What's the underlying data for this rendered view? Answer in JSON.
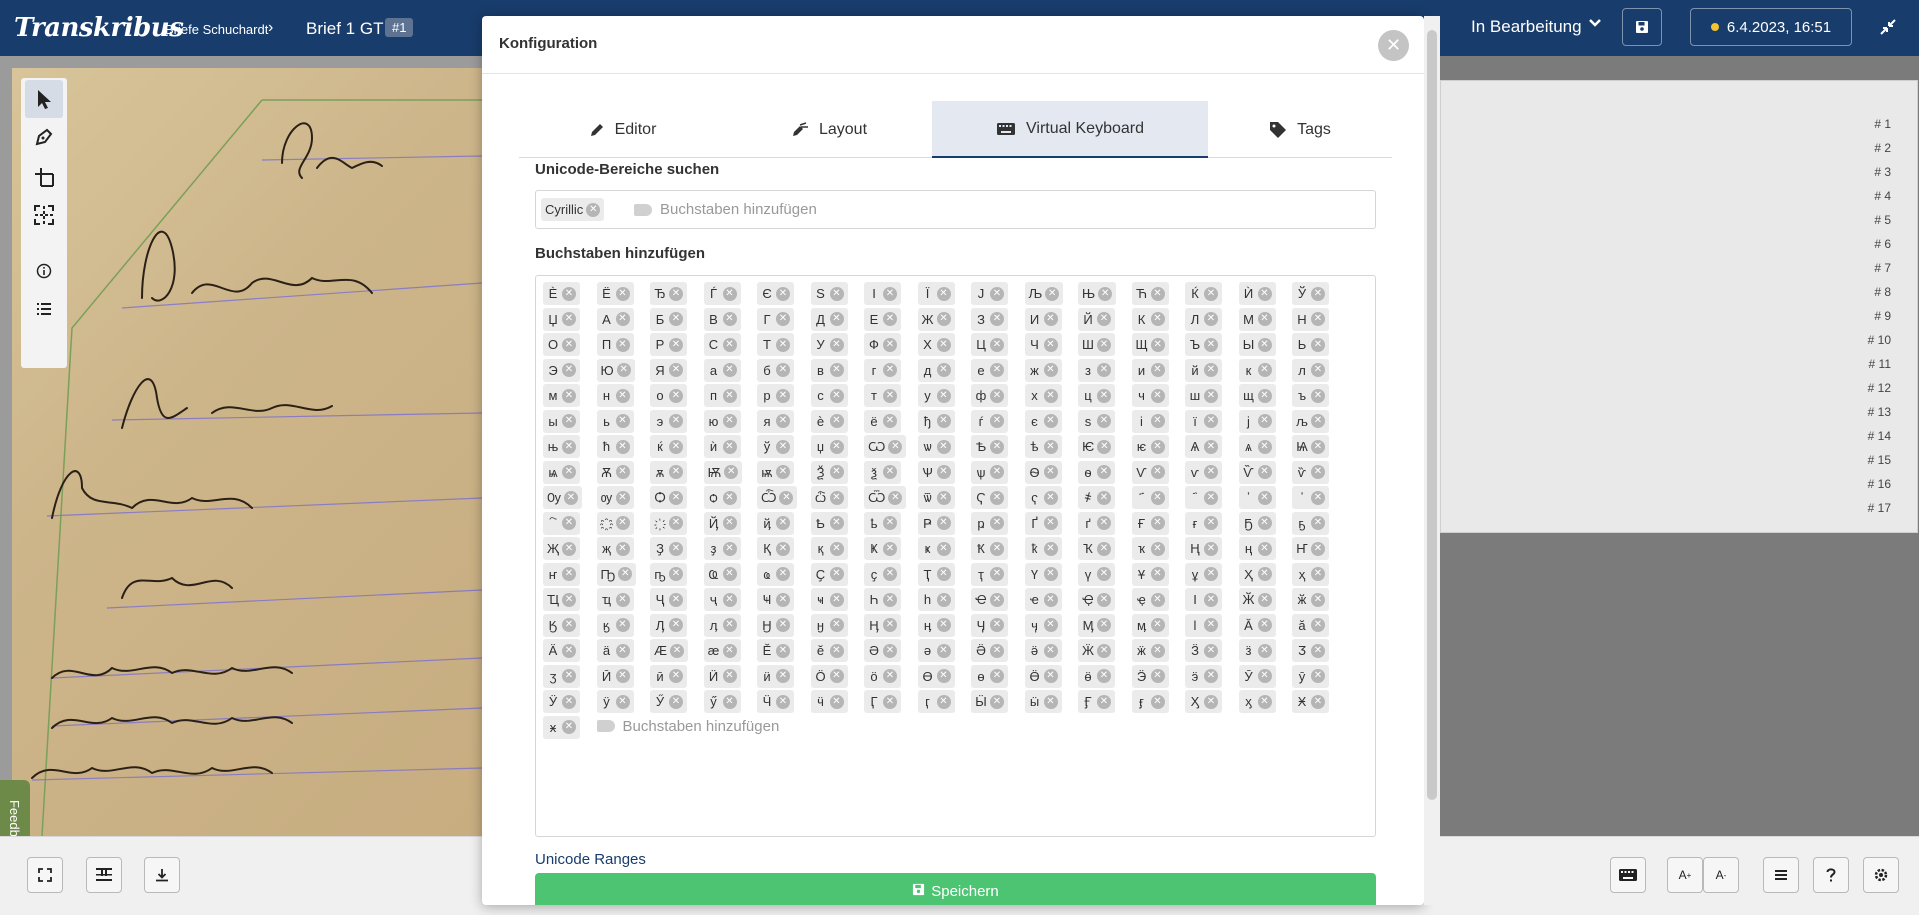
{
  "topbar": {
    "logo": "Transkribus",
    "breadcrumb_collection": "Briefe Schuchardt",
    "breadcrumb_sep": "›",
    "breadcrumb_document": "Brief 1 GT",
    "document_badge": "#1",
    "status": "In Bearbeitung",
    "date": "6.4.2023, 16:51"
  },
  "feedback_label": "Feedback",
  "line_numbers": [
    "# 1",
    "# 2",
    "# 3",
    "# 4",
    "# 5",
    "# 6",
    "# 7",
    "# 8",
    "# 9",
    "# 10",
    "# 11",
    "# 12",
    "# 13",
    "# 14",
    "# 15",
    "# 16",
    "# 17"
  ],
  "modal": {
    "title": "Konfiguration",
    "tabs": [
      {
        "label": "Editor",
        "icon": "pencil-icon"
      },
      {
        "label": "Layout",
        "icon": "layout-icon"
      },
      {
        "label": "Virtual Keyboard",
        "icon": "keyboard-icon"
      },
      {
        "label": "Tags",
        "icon": "tag-icon"
      }
    ],
    "active_tab": "Virtual Keyboard",
    "unicode_search_label": "Unicode-Bereiche suchen",
    "selected_range": "Cyrillic",
    "search_placeholder": "Buchstaben hinzufügen",
    "letters_label": "Buchstaben hinzufügen",
    "letters_placeholder": "Buchstaben hinzufügen",
    "letters": [
      "Ѐ",
      "Ё",
      "Ђ",
      "Ѓ",
      "Є",
      "Ѕ",
      "І",
      "Ї",
      "Ј",
      "Љ",
      "Њ",
      "Ћ",
      "Ќ",
      "Ѝ",
      "Ў",
      "Џ",
      "А",
      "Б",
      "В",
      "Г",
      "Д",
      "Е",
      "Ж",
      "З",
      "И",
      "Й",
      "К",
      "Л",
      "М",
      "Н",
      "О",
      "П",
      "Р",
      "С",
      "Т",
      "У",
      "Ф",
      "Х",
      "Ц",
      "Ч",
      "Ш",
      "Щ",
      "Ъ",
      "Ы",
      "Ь",
      "Э",
      "Ю",
      "Я",
      "а",
      "б",
      "в",
      "г",
      "д",
      "е",
      "ж",
      "з",
      "и",
      "й",
      "к",
      "л",
      "м",
      "н",
      "о",
      "п",
      "р",
      "с",
      "т",
      "у",
      "ф",
      "х",
      "ц",
      "ч",
      "ш",
      "щ",
      "ъ",
      "ы",
      "ь",
      "э",
      "ю",
      "я",
      "ѐ",
      "ё",
      "ђ",
      "ѓ",
      "є",
      "ѕ",
      "і",
      "ї",
      "ј",
      "љ",
      "њ",
      "ћ",
      "ќ",
      "ѝ",
      "ў",
      "џ",
      "Ѡ",
      "ѡ",
      "Ѣ",
      "ѣ",
      "Ѥ",
      "ѥ",
      "Ѧ",
      "ѧ",
      "Ѩ",
      "ѩ",
      "Ѫ",
      "ѫ",
      "Ѭ",
      "ѭ",
      "Ѯ",
      "ѯ",
      "Ѱ",
      "ѱ",
      "Ѳ",
      "ѳ",
      "Ѵ",
      "ѵ",
      "Ѷ",
      "ѷ",
      "Ѹ",
      "ѹ",
      "Ѻ",
      "ѻ",
      "Ѽ",
      "ѽ",
      "Ѿ",
      "ѿ",
      "Ҁ",
      "ҁ",
      "҂",
      "҃",
      "҄",
      "҅",
      "҆",
      "҇",
      "҈",
      "҉",
      "Ҋ",
      "ҋ",
      "Ҍ",
      "ҍ",
      "Ҏ",
      "ҏ",
      "Ґ",
      "ґ",
      "Ғ",
      "ғ",
      "Ҕ",
      "ҕ",
      "Җ",
      "җ",
      "Ҙ",
      "ҙ",
      "Қ",
      "қ",
      "Ҝ",
      "ҝ",
      "Ҟ",
      "ҟ",
      "Ҡ",
      "ҡ",
      "Ң",
      "ң",
      "Ҥ",
      "ҥ",
      "Ҧ",
      "ҧ",
      "Ҩ",
      "ҩ",
      "Ҫ",
      "ҫ",
      "Ҭ",
      "ҭ",
      "Ү",
      "ү",
      "Ұ",
      "ұ",
      "Ҳ",
      "ҳ",
      "Ҵ",
      "ҵ",
      "Ҷ",
      "ҷ",
      "Ҹ",
      "ҹ",
      "Һ",
      "һ",
      "Ҽ",
      "ҽ",
      "Ҿ",
      "ҿ",
      "Ӏ",
      "Ӂ",
      "ӂ",
      "Ӄ",
      "ӄ",
      "Ӆ",
      "ӆ",
      "Ӈ",
      "ӈ",
      "Ӊ",
      "ӊ",
      "Ӌ",
      "ӌ",
      "Ӎ",
      "ӎ",
      "ӏ",
      "Ӑ",
      "ӑ",
      "Ӓ",
      "ӓ",
      "Ӕ",
      "ӕ",
      "Ӗ",
      "ӗ",
      "Ә",
      "ә",
      "Ӛ",
      "ӛ",
      "Ӝ",
      "ӝ",
      "Ӟ",
      "ӟ",
      "Ӡ",
      "ӡ",
      "Ӣ",
      "ӣ",
      "Ӥ",
      "ӥ",
      "Ӧ",
      "ӧ",
      "Ө",
      "ө",
      "Ӫ",
      "ӫ",
      "Ӭ",
      "ӭ",
      "Ӯ",
      "ӯ",
      "Ӱ",
      "ӱ",
      "Ӳ",
      "ӳ",
      "Ӵ",
      "ӵ",
      "Ӷ",
      "ӷ",
      "Ӹ",
      "ӹ",
      "Ӻ",
      "ӻ",
      "Ӽ",
      "ӽ",
      "Ӿ",
      "ӿ"
    ],
    "unicode_ranges_link": "Unicode Ranges",
    "save_label": "Speichern"
  },
  "colors": {
    "topbar": "#183c6b",
    "save_button": "#4dc472",
    "status_dot": "#f2c230"
  }
}
